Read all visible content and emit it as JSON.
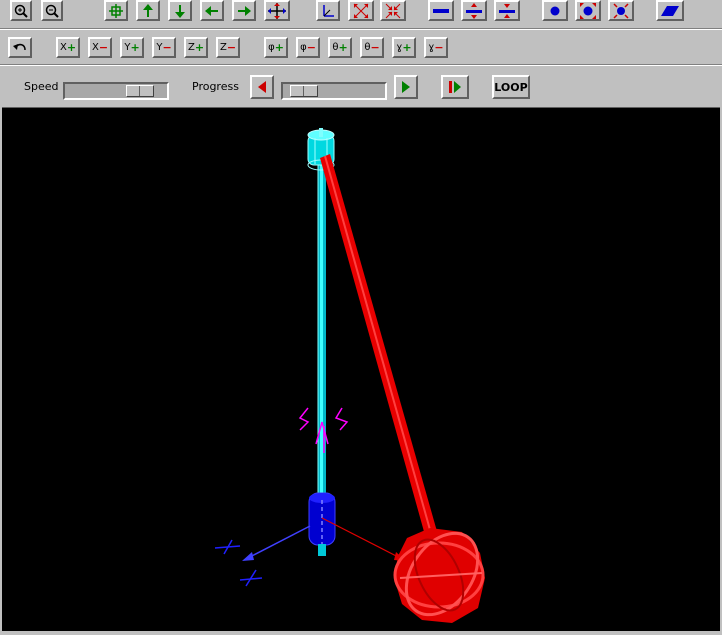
{
  "toolbar_row1": {
    "buttons": [
      {
        "name": "zoom-in-button",
        "icon": "magnifier-plus-icon"
      },
      {
        "name": "zoom-out-button",
        "icon": "magnifier-minus-icon"
      },
      {
        "name": "center-button",
        "icon": "crosshair-grid-icon"
      },
      {
        "name": "pan-up-button",
        "icon": "arrow-up-icon"
      },
      {
        "name": "pan-down-button",
        "icon": "arrow-down-icon"
      },
      {
        "name": "pan-left-button",
        "icon": "arrow-left-icon"
      },
      {
        "name": "pan-right-button",
        "icon": "arrow-right-icon"
      },
      {
        "name": "pan-all-button",
        "icon": "four-way-arrows-icon"
      },
      {
        "name": "axes-button",
        "icon": "axes-icon"
      },
      {
        "name": "expand-button",
        "icon": "expand-arrows-icon"
      },
      {
        "name": "contract-button",
        "icon": "contract-arrows-icon"
      },
      {
        "name": "line-thin-button",
        "icon": "line-icon"
      },
      {
        "name": "line-expand-button",
        "icon": "line-expand-icon"
      },
      {
        "name": "line-contract-button",
        "icon": "line-contract-icon"
      },
      {
        "name": "point-button",
        "icon": "dot-icon"
      },
      {
        "name": "point-expand-button",
        "icon": "dot-expand-icon"
      },
      {
        "name": "point-contract-button",
        "icon": "dot-contract-icon"
      },
      {
        "name": "plane-button",
        "icon": "parallelogram-icon"
      }
    ]
  },
  "toolbar_row2": {
    "undo": {
      "icon": "undo-arrow-icon"
    },
    "axis_buttons": [
      {
        "axis": "X",
        "sign": "+",
        "color": "#008000"
      },
      {
        "axis": "X",
        "sign": "−",
        "color": "#cc0000"
      },
      {
        "axis": "Y",
        "sign": "+",
        "color": "#008000"
      },
      {
        "axis": "Y",
        "sign": "−",
        "color": "#cc0000"
      },
      {
        "axis": "Z",
        "sign": "+",
        "color": "#008000"
      },
      {
        "axis": "Z",
        "sign": "−",
        "color": "#cc0000"
      }
    ],
    "angle_buttons": [
      {
        "axis": "φ",
        "sign": "+",
        "color": "#008000"
      },
      {
        "axis": "φ",
        "sign": "−",
        "color": "#cc0000"
      },
      {
        "axis": "θ",
        "sign": "+",
        "color": "#008000"
      },
      {
        "axis": "θ",
        "sign": "−",
        "color": "#cc0000"
      },
      {
        "axis": "ɣ",
        "sign": "+",
        "color": "#008000"
      },
      {
        "axis": "ɣ",
        "sign": "−",
        "color": "#cc0000"
      }
    ]
  },
  "toolbar_row3": {
    "speed_label": "Speed",
    "speed_value": 0.83,
    "progress_label": "Progress",
    "progress_value": 0.1,
    "loop_label": "LOOP",
    "step_back_icon": "triangle-left-icon",
    "step_forward_icon": "triangle-right-icon",
    "play_icon": "play-pause-icon"
  },
  "colors": {
    "background": "#c0c0c0",
    "viewport": "#000000",
    "cyan_link": "#00e0e0",
    "red_link": "#ff0000",
    "blue_joint": "#0000ff",
    "magenta_marker": "#ff00ff"
  }
}
